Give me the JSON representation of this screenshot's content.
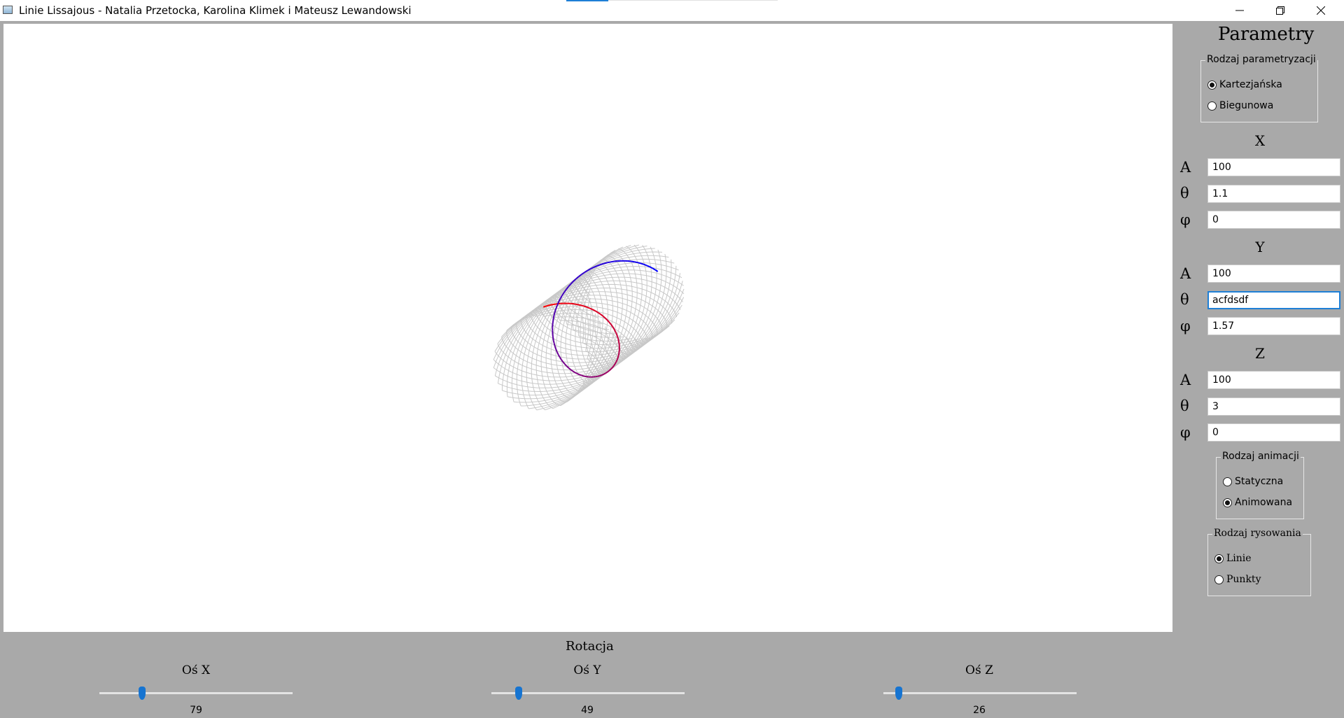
{
  "window": {
    "title": "Linie Lissajous - Natalia Przetocka, Karolina Klimek i Mateusz Lewandowski",
    "icon": "app-icon",
    "controls": [
      "minimize-icon",
      "restore-icon",
      "close-icon"
    ]
  },
  "canvas": {
    "background": "#ffffff",
    "colors": {
      "wire": "#c8c8c8",
      "curve_start": "#ff0000",
      "curve_end": "#0000ff"
    }
  },
  "panel": {
    "title": "Parametry",
    "parametrization": {
      "legend": "Rodzaj parametryzacji",
      "options": [
        {
          "label": "Kartezjańska",
          "selected": true
        },
        {
          "label": "Biegunowa",
          "selected": false
        }
      ]
    },
    "x": {
      "header": "X",
      "a_label": "A",
      "theta_label": "θ",
      "phi_label": "φ",
      "a": "100",
      "theta": "1.1",
      "phi": "0"
    },
    "y": {
      "header": "Y",
      "a_label": "A",
      "theta_label": "θ",
      "phi_label": "φ",
      "a": "100",
      "theta": "acfdsdf",
      "phi": "1.57"
    },
    "z": {
      "header": "Z",
      "a_label": "A",
      "theta_label": "θ",
      "phi_label": "φ",
      "a": "100",
      "theta": "3",
      "phi": "0"
    },
    "animation": {
      "legend": "Rodzaj animacji",
      "options": [
        {
          "label": "Statyczna",
          "selected": false
        },
        {
          "label": "Animowana",
          "selected": true
        }
      ]
    },
    "drawing": {
      "legend": "Rodzaj rysowania",
      "options": [
        {
          "label": "Linie",
          "selected": true
        },
        {
          "label": "Punkty",
          "selected": false
        }
      ]
    }
  },
  "rotation": {
    "title": "Rotacja",
    "accent": "#1674d1",
    "sliders": [
      {
        "label": "Oś X",
        "value": "79",
        "fraction": 0.22
      },
      {
        "label": "Oś Y",
        "value": "49",
        "fraction": 0.14
      },
      {
        "label": "Oś Z",
        "value": "26",
        "fraction": 0.08
      }
    ]
  }
}
